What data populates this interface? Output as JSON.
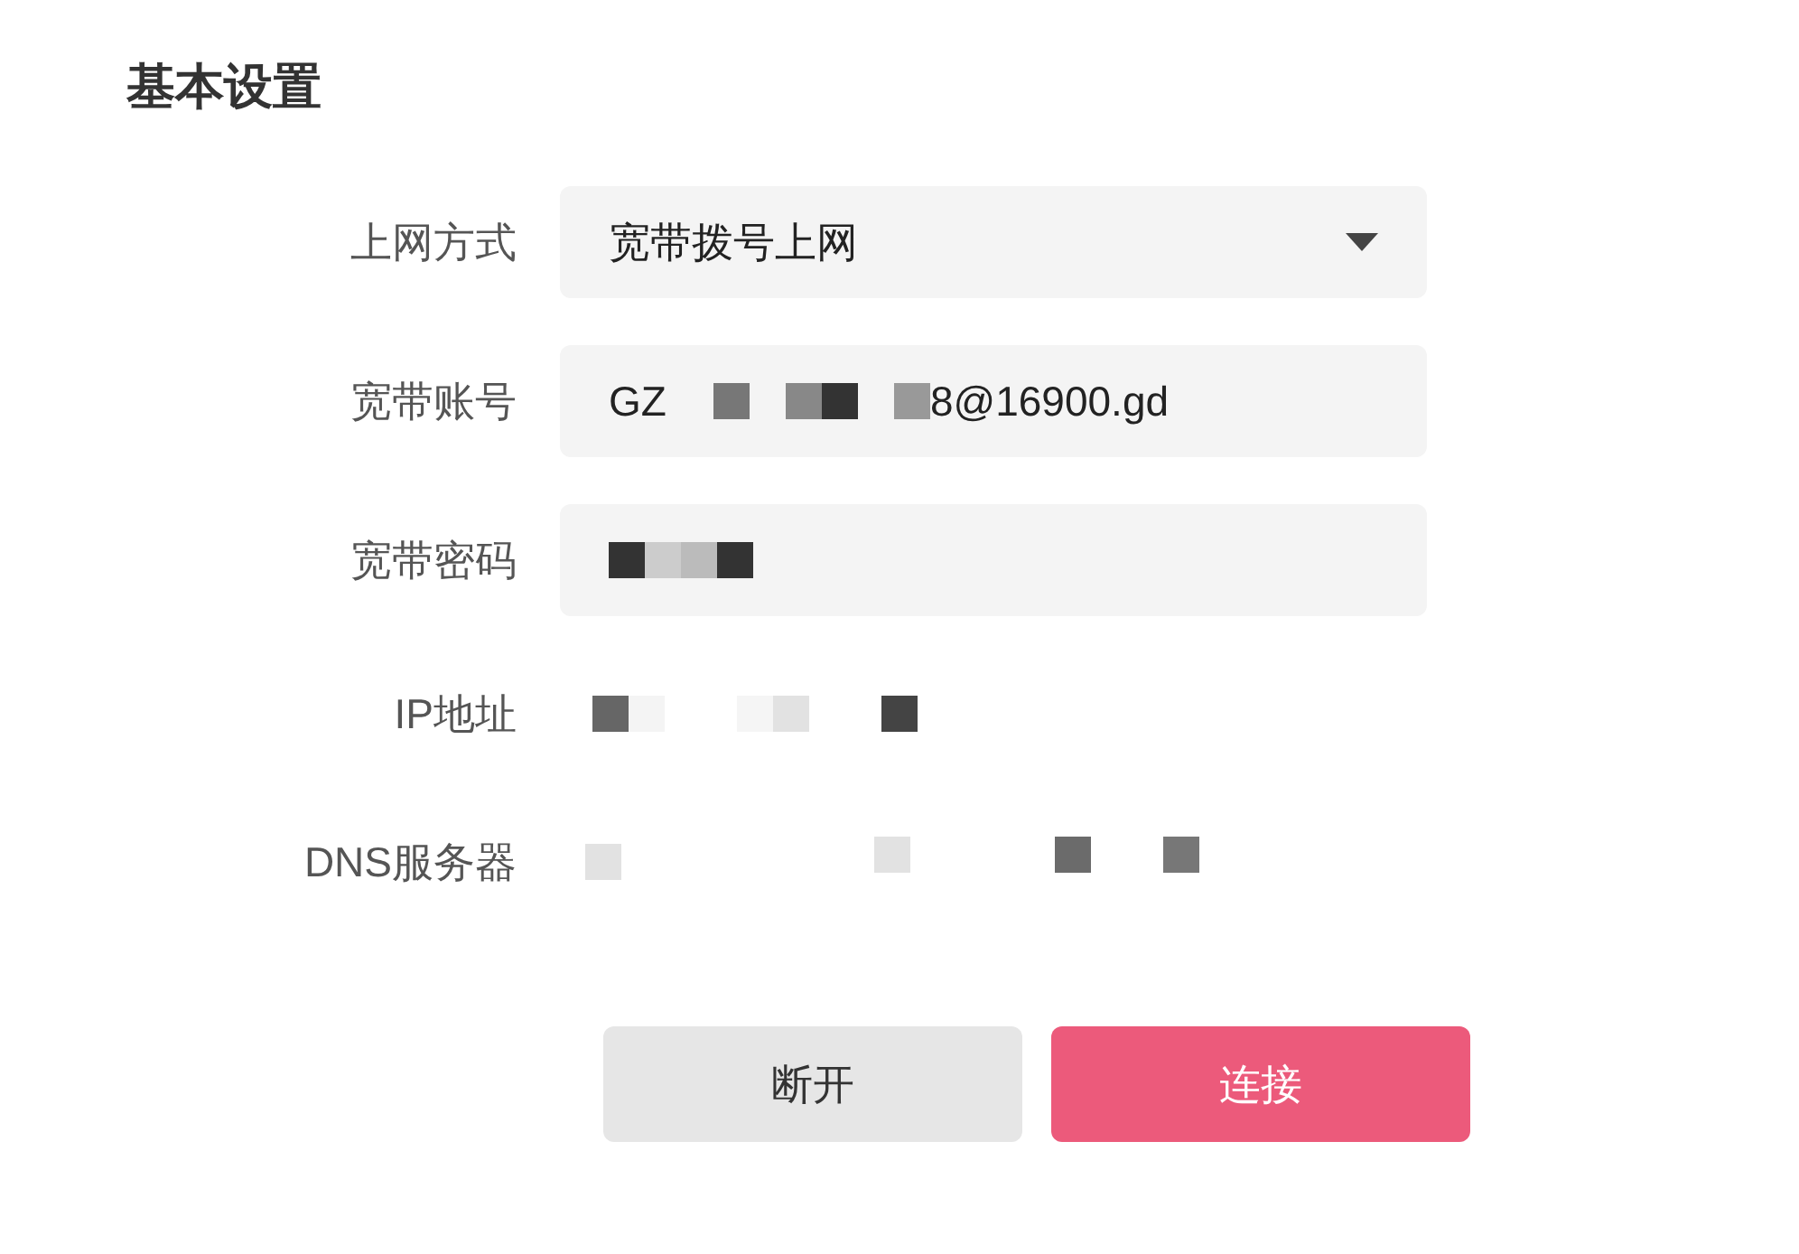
{
  "title": "基本设置",
  "fields": [
    {
      "kind": "select",
      "label": "上网方式",
      "value": "宽带拨号上网"
    },
    {
      "kind": "account",
      "label": "宽带账号",
      "value_parts": [
        "GZ",
        "8@16900.gd"
      ]
    },
    {
      "kind": "password",
      "label": "宽带密码"
    },
    {
      "kind": "ip",
      "label": "IP地址"
    },
    {
      "kind": "dns",
      "label": "DNS服务器"
    }
  ],
  "buttons": [
    {
      "kind": "secondary",
      "label": "断开"
    },
    {
      "kind": "primary",
      "label": "连接"
    }
  ]
}
